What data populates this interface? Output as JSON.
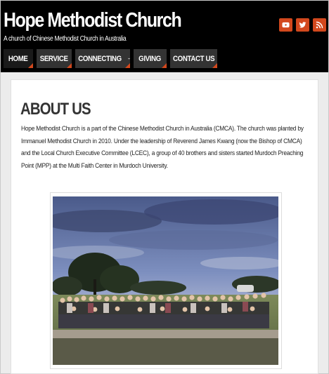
{
  "site": {
    "title": "Hope Methodist Church",
    "tagline": "A church of Chinese Methodist Church in Australia"
  },
  "social": [
    {
      "icon": "youtube-icon"
    },
    {
      "icon": "twitter-icon"
    },
    {
      "icon": "rss-icon"
    }
  ],
  "nav": {
    "items": [
      {
        "label": "HOME",
        "active": true
      },
      {
        "label": "SERVICE"
      },
      {
        "label": "CONNECTING",
        "has_dropdown": true
      },
      {
        "label": "GIVING"
      },
      {
        "label": "CONTACT US"
      }
    ]
  },
  "main": {
    "heading": "ABOUT US",
    "intro": "Hope Methodist Church is a part of the Chinese Methodist Church in Australia (CMCA). The church was planted by Immanuel Methodist Church in 2010. Under the leadership of Reverend James Kwang (now the Bishop of CMCA) and the Local Church Executive Committee (LCEC), a group of 40 brothers and sisters started Murdoch Preaching Point (MPP) at the Multi Faith Center in Murdoch University."
  },
  "colors": {
    "header_bg": "#000000",
    "accent": "#d2481d",
    "nav_bg": "#333333"
  }
}
